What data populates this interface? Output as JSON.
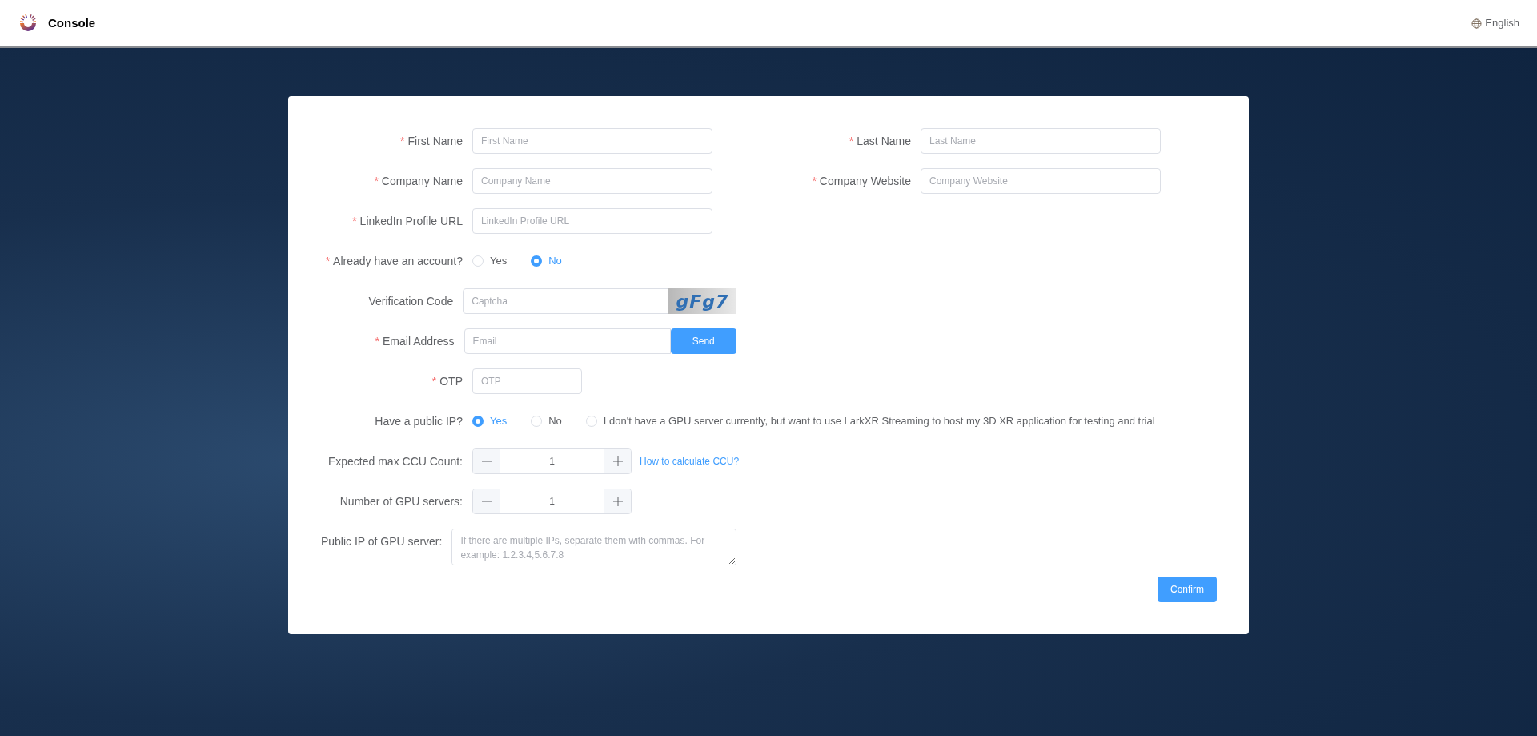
{
  "header": {
    "title": "Console",
    "language": "English"
  },
  "form": {
    "rows": [
      [
        {
          "kind": "text",
          "required_mark": "*",
          "label": "First Name",
          "placeholder": "First Name"
        },
        {
          "kind": "text",
          "required_mark": "*",
          "label": "Last Name",
          "placeholder": "Last Name"
        }
      ],
      [
        {
          "kind": "text",
          "required_mark": "*",
          "label": "Company Name",
          "placeholder": "Company Name"
        },
        {
          "kind": "text",
          "required_mark": "*",
          "label": "Company Website",
          "placeholder": "Company Website"
        }
      ],
      [
        {
          "kind": "text",
          "required_mark": "*",
          "label": "LinkedIn Profile URL",
          "placeholder": "LinkedIn Profile URL"
        }
      ],
      [
        {
          "kind": "radio",
          "required_mark": "*",
          "label": "Already have an account?",
          "options": [
            {
              "label": "Yes",
              "selected": false
            },
            {
              "label": "No",
              "selected": true
            }
          ]
        }
      ],
      [
        {
          "kind": "captcha",
          "label": "Verification Code",
          "placeholder": "Captcha",
          "captcha": "gFg7"
        }
      ],
      [
        {
          "kind": "email",
          "required_mark": "*",
          "label": "Email Address",
          "placeholder": "Email",
          "button": "Send"
        }
      ],
      [
        {
          "kind": "short",
          "required_mark": "*",
          "label": "OTP",
          "placeholder": "OTP"
        }
      ],
      [
        {
          "kind": "radio",
          "label": "Have a public IP?",
          "options": [
            {
              "label": "Yes",
              "selected": true
            },
            {
              "label": "No",
              "selected": false
            },
            {
              "label": "I don't have a GPU server currently, but want to use LarkXR Streaming to host my 3D XR application for testing and trial",
              "selected": false
            }
          ]
        }
      ],
      [
        {
          "kind": "stepper",
          "label": "Expected max CCU Count:",
          "value": "1",
          "link": "How to calculate CCU?"
        }
      ],
      [
        {
          "kind": "stepper",
          "label": "Number of GPU servers:",
          "value": "1"
        }
      ],
      [
        {
          "kind": "textarea",
          "label": "Public IP of GPU server:",
          "placeholder": "If there are multiple IPs, separate them with commas. For example: 1.2.3.4,5.6.7.8"
        }
      ]
    ],
    "confirm": "Confirm"
  }
}
